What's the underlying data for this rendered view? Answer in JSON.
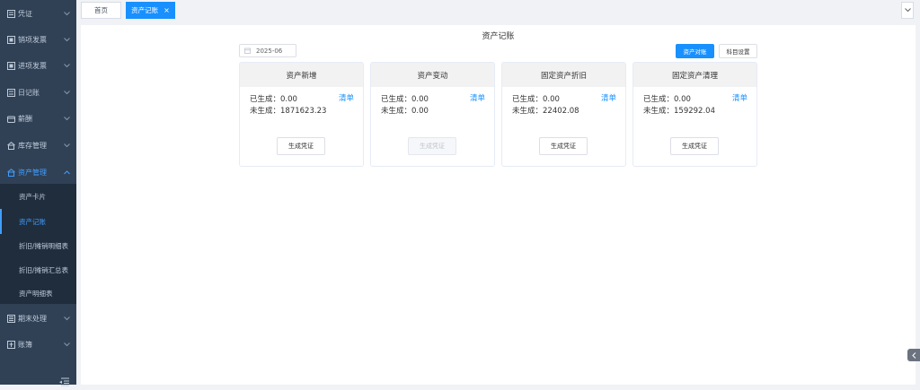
{
  "sidebar": {
    "menu": [
      {
        "label": "凭证",
        "icon": "voucher-icon"
      },
      {
        "label": "销项发票",
        "icon": "invoice-icon"
      },
      {
        "label": "进项发票",
        "icon": "invoice-icon"
      },
      {
        "label": "日记账",
        "icon": "journal-icon"
      },
      {
        "label": "薪酬",
        "icon": "salary-icon"
      },
      {
        "label": "库存管理",
        "icon": "warehouse-icon"
      },
      {
        "label": "资产管理",
        "icon": "asset-icon"
      },
      {
        "label": "期末处理",
        "icon": "period-end-icon"
      },
      {
        "label": "账簿",
        "icon": "ledger-icon"
      }
    ],
    "asset_submenu": [
      {
        "label": "资产卡片"
      },
      {
        "label": "资产记账"
      },
      {
        "label": "折旧/摊销明细表"
      },
      {
        "label": "折旧/摊销汇总表"
      },
      {
        "label": "资产明细表"
      }
    ]
  },
  "tabs": [
    {
      "label": "首页"
    },
    {
      "label": "资产记账"
    }
  ],
  "main": {
    "title": "资产记账",
    "date_value": "2025-06",
    "buttons": {
      "reconcile": "资产对账",
      "subject_settings": "科目设置"
    },
    "cards": [
      {
        "title": "资产新增",
        "generated_label": "已生成：",
        "generated": "0.00",
        "not_generated_label": "未生成：",
        "not_generated": "1871623.23",
        "link": "清单",
        "action": "生成凭证",
        "disabled": false
      },
      {
        "title": "资产变动",
        "generated_label": "已生成：",
        "generated": "0.00",
        "not_generated_label": "未生成：",
        "not_generated": "0.00",
        "link": "清单",
        "action": "生成凭证",
        "disabled": true
      },
      {
        "title": "固定资产折旧",
        "generated_label": "已生成：",
        "generated": "0.00",
        "not_generated_label": "未生成：",
        "not_generated": "22402.08",
        "link": "清单",
        "action": "生成凭证",
        "disabled": false
      },
      {
        "title": "固定资产清理",
        "generated_label": "已生成：",
        "generated": "0.00",
        "not_generated_label": "未生成：",
        "not_generated": "159292.04",
        "link": "清单",
        "action": "生成凭证",
        "disabled": false
      }
    ]
  },
  "colors": {
    "sidebar_bg": "#304156",
    "submenu_bg": "#1f2d3d",
    "accent": "#1890ff",
    "menu_active": "#409eff"
  }
}
